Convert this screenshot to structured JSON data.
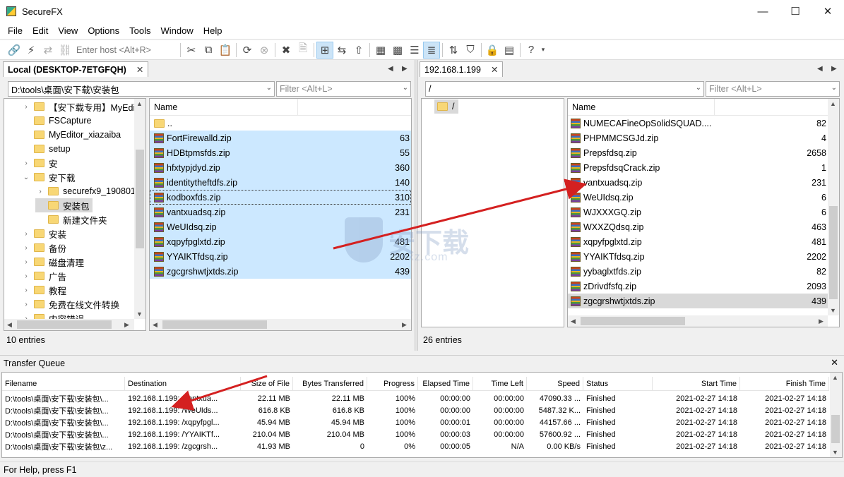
{
  "window": {
    "title": "SecureFX",
    "minimize": "—",
    "maximize": "☐",
    "close": "✕"
  },
  "menu": [
    "File",
    "Edit",
    "View",
    "Options",
    "Tools",
    "Window",
    "Help"
  ],
  "toolbar": {
    "host_placeholder": "Enter host <Alt+R>"
  },
  "local": {
    "tab_label": "Local (DESKTOP-7ETGFQH)",
    "tab_close": "✕",
    "path": "D:\\tools\\桌面\\安下载\\安装包",
    "filter_placeholder": "Filter <Alt+L>",
    "tree": [
      {
        "label": "【安下载专用】MyEdi",
        "level": 1,
        "chev": "›"
      },
      {
        "label": "FSCapture",
        "level": 1,
        "chev": ""
      },
      {
        "label": "MyEditor_xiazaiba",
        "level": 1,
        "chev": ""
      },
      {
        "label": "setup",
        "level": 1,
        "chev": ""
      },
      {
        "label": "安",
        "level": 1,
        "chev": "›"
      },
      {
        "label": "安下载",
        "level": 1,
        "chev": "⌄"
      },
      {
        "label": "securefx9_190801",
        "level": 2,
        "chev": "›"
      },
      {
        "label": "安装包",
        "level": 2,
        "chev": ""
      },
      {
        "label": "新建文件夹",
        "level": 2,
        "chev": ""
      },
      {
        "label": "安装",
        "level": 1,
        "chev": "›"
      },
      {
        "label": "备份",
        "level": 1,
        "chev": "›"
      },
      {
        "label": "磁盘清理",
        "level": 1,
        "chev": "›"
      },
      {
        "label": "广告",
        "level": 1,
        "chev": "›"
      },
      {
        "label": "教程",
        "level": 1,
        "chev": "›"
      },
      {
        "label": "免费在线文件转换",
        "level": 1,
        "chev": "›"
      },
      {
        "label": "内容错误",
        "level": 1,
        "chev": "›"
      }
    ],
    "col_name": "Name",
    "files": [
      {
        "name": "..",
        "size": "",
        "type": "folder",
        "sel": false
      },
      {
        "name": "FortFirewalld.zip",
        "size": "63",
        "type": "zip",
        "sel": true
      },
      {
        "name": "HDBtpmsfds.zip",
        "size": "55",
        "type": "zip",
        "sel": true
      },
      {
        "name": "hfxtypjdyd.zip",
        "size": "360",
        "type": "zip",
        "sel": true
      },
      {
        "name": "identitytheftdfs.zip",
        "size": "140",
        "type": "zip",
        "sel": true
      },
      {
        "name": "kodboxfds.zip",
        "size": "310",
        "type": "zip",
        "sel": true
      },
      {
        "name": "vantxuadsq.zip",
        "size": "231",
        "type": "zip",
        "sel": true
      },
      {
        "name": "WeUIdsq.zip",
        "size": "",
        "type": "zip",
        "sel": true
      },
      {
        "name": "xqpyfpglxtd.zip",
        "size": "481",
        "type": "zip",
        "sel": true
      },
      {
        "name": "YYAIKTfdsq.zip",
        "size": "2202",
        "type": "zip",
        "sel": true
      },
      {
        "name": "zgcgrshwtjxtds.zip",
        "size": "439",
        "type": "zip",
        "sel": true
      }
    ],
    "entries": "10 entries"
  },
  "remote": {
    "tab_label": "192.168.1.199",
    "tab_close": "✕",
    "path": "/",
    "filter_placeholder": "Filter <Alt+L>",
    "tree_root": "/",
    "col_name": "Name",
    "files": [
      {
        "name": "NUMECAFineOpSolidSQUAD....",
        "size": "82"
      },
      {
        "name": "PHPMMCSGJd.zip",
        "size": "4"
      },
      {
        "name": "Prepsfdsq.zip",
        "size": "2658"
      },
      {
        "name": "PrepsfdsqCrack.zip",
        "size": "1"
      },
      {
        "name": "vantxuadsq.zip",
        "size": "231"
      },
      {
        "name": "WeUIdsq.zip",
        "size": "6"
      },
      {
        "name": "WJXXXGQ.zip",
        "size": "6"
      },
      {
        "name": "WXXZQdsq.zip",
        "size": "463"
      },
      {
        "name": "xqpyfpglxtd.zip",
        "size": "481"
      },
      {
        "name": "YYAIKTfdsq.zip",
        "size": "2202"
      },
      {
        "name": "yybaglxtfds.zip",
        "size": "82"
      },
      {
        "name": "zDrivdfsfq.zip",
        "size": "2093"
      },
      {
        "name": "zgcgrshwtjxtds.zip",
        "size": "439"
      }
    ],
    "entries": "26 entries"
  },
  "queue": {
    "title": "Transfer Queue",
    "close": "✕",
    "columns": [
      "Filename",
      "Destination",
      "Size of File",
      "Bytes Transferred",
      "Progress",
      "Elapsed Time",
      "Time Left",
      "Speed",
      "Status",
      "Start Time",
      "Finish Time"
    ],
    "rows": [
      [
        "D:\\tools\\桌面\\安下载\\安装包\\...",
        "192.168.1.199: /vantxua...",
        "22.11 MB",
        "22.11 MB",
        "100%",
        "00:00:00",
        "00:00:00",
        "47090.33 ...",
        "Finished",
        "2021-02-27 14:18",
        "2021-02-27 14:18"
      ],
      [
        "D:\\tools\\桌面\\安下载\\安装包\\...",
        "192.168.1.199: /WeUIds...",
        "616.8 KB",
        "616.8 KB",
        "100%",
        "00:00:00",
        "00:00:00",
        "5487.32 K...",
        "Finished",
        "2021-02-27 14:18",
        "2021-02-27 14:18"
      ],
      [
        "D:\\tools\\桌面\\安下载\\安装包\\...",
        "192.168.1.199: /xqpyfpgl...",
        "45.94 MB",
        "45.94 MB",
        "100%",
        "00:00:01",
        "00:00:00",
        "44157.66 ...",
        "Finished",
        "2021-02-27 14:18",
        "2021-02-27 14:18"
      ],
      [
        "D:\\tools\\桌面\\安下载\\安装包\\...",
        "192.168.1.199: /YYAIKTf...",
        "210.04 MB",
        "210.04 MB",
        "100%",
        "00:00:03",
        "00:00:00",
        "57600.92 ...",
        "Finished",
        "2021-02-27 14:18",
        "2021-02-27 14:18"
      ],
      [
        "D:\\tools\\桌面\\安下载\\安装包\\z...",
        "192.168.1.199: /zgcgrsh...",
        "41.93 MB",
        "0",
        "0%",
        "00:00:05",
        "N/A",
        "0.00 KB/s",
        "Finished",
        "2021-02-27 14:18",
        "2021-02-27 14:18"
      ]
    ]
  },
  "watermark": {
    "text": "安下载",
    "url": "anxz.com"
  },
  "status_bar": "For Help, press F1",
  "colors": {
    "selection": "#cce8ff",
    "arrow": "#d42020"
  }
}
